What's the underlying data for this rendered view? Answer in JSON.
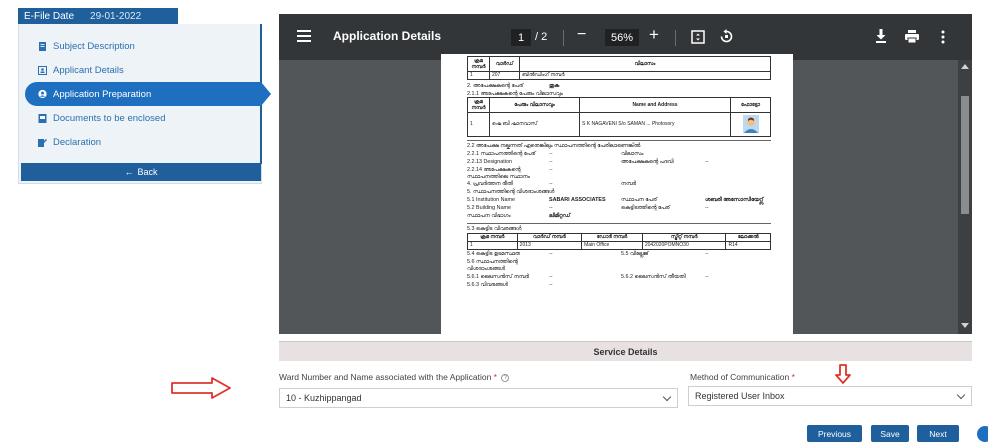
{
  "efile": {
    "label": "E-File Date",
    "date": "29-01-2022"
  },
  "sidebar": {
    "items": [
      {
        "label": "Subject Description",
        "icon": "file-icon"
      },
      {
        "label": "Applicant Details",
        "icon": "id-card-icon"
      },
      {
        "label": "Application Preparation",
        "icon": "user-circle-icon",
        "active": true
      },
      {
        "label": "Documents to be enclosed",
        "icon": "document-icon"
      },
      {
        "label": "Declaration",
        "icon": "pen-icon"
      }
    ],
    "back_label": "Back"
  },
  "viewer": {
    "title": "Application Details",
    "page_current": "1",
    "page_total": "/ 2",
    "zoom": "56%",
    "icons": [
      "menu-icon",
      "fit-page-icon",
      "rotate-icon",
      "download-icon",
      "print-icon",
      "more-icon"
    ]
  },
  "document": {
    "top_table_headers": [
      "ക്രമ നമ്പർ",
      "വാർഡ്",
      "വിലാസം"
    ],
    "top_table_row": [
      "1",
      "207",
      "ബിൽഡിംഗ് നമ്പർ"
    ],
    "row_2": [
      "2. അപേക്ഷകന്റെ പേര്",
      "തുക"
    ],
    "row_2_1": "2.1.1 അപേക്ഷകന്റെ പേരും വിലാസവും",
    "owner_table_headers": [
      "ക്രമ നമ്പർ",
      "പേരും വിലാസവും",
      "Name and Address",
      "ഫോട്ടോ"
    ],
    "owner_table_row": [
      "1",
      "ഷെ ബി ഷാനവാസ്",
      "S K NAGAVENI S/o SAMAN ...",
      "Photosory"
    ],
    "row_2_2": "2.2 അപേക്ഷ നല്കുന്നത് ഏതെങ്കിലും സ്ഥാപനത്തിന്റെ പേരിലാണെങ്കിൽ",
    "rows_a": [
      [
        "2.2.1 സ്ഥാപനത്തിന്റെ പേര്",
        "--",
        "വിലാസം",
        ""
      ],
      [
        "2.2.13 Designation",
        "--",
        "അപേക്ഷകന്റെ പദവി",
        "--"
      ],
      [
        "2.2.14 അപേക്ഷകന്റെ സ്ഥാപനത്തിലെ സ്ഥാനം",
        "--",
        "",
        ""
      ],
      [
        "4. പ്രവർത്തന രീതി",
        "--",
        "നമ്പർ",
        ""
      ]
    ],
    "row_5": "5. സ്ഥാപനത്തിന്റെ വിശദാംശങ്ങൾ",
    "rows_b": [
      [
        "5.1 Institution Name",
        "SABARI ASSOCIATES",
        "സ്ഥാപന പേര്",
        "ശബരി അസോസിയേറ്റ്സ്"
      ],
      [
        "5.2 Building Name",
        "--",
        "കെട്ടിടത്തിന്റെ പേര്",
        "--"
      ],
      [
        "സ്ഥാപന വിഭാഗം",
        "ലിമിറ്റഡ്",
        "",
        ""
      ]
    ],
    "row_5_3": "5.3 കെട്ടിട വിവരങ്ങൾ",
    "bldg_table_headers": [
      "ക്രമ നമ്പർ",
      "വാർഡ് നമ്പർ",
      "ഡോർ നമ്പർ",
      "സ്ട്രീറ്റ് നമ്പർ",
      "ലോക്കൽ"
    ],
    "bldg_table_row": [
      "1",
      "2013",
      "Main Office",
      "2042020POMNO30",
      "R14"
    ],
    "rows_c": [
      [
        "5.4 കെട്ടിട ഉടമസ്ഥത",
        "--",
        "5.5 വില്ലേജ്",
        "--"
      ],
      [
        "5.6 സ്ഥാപനത്തിന്റെ വിശദാംശങ്ങൾ",
        "",
        "",
        ""
      ],
      [
        "5.6.1 ലൈസൻസ് നമ്പർ",
        "--",
        "5.6.2 ലൈസൻസ് തീയതി",
        "--"
      ],
      [
        "5.6.3 വിവരങ്ങൾ",
        "--",
        "",
        ""
      ]
    ]
  },
  "service": {
    "header": "Service Details",
    "ward_label": "Ward Number and Name associated with the Application",
    "ward_value": "10 - Kuzhippangad",
    "method_label": "Method of Communication",
    "method_value": "Registered User Inbox",
    "required_mark": "*"
  },
  "buttons": {
    "previous": "Previous",
    "save": "Save",
    "next": "Next"
  },
  "colors": {
    "primary": "#1f5f9c",
    "accent": "#1f6fc0",
    "toolbar": "#323639",
    "viewer_bg": "#525659",
    "annotation_red": "#e0332c"
  }
}
